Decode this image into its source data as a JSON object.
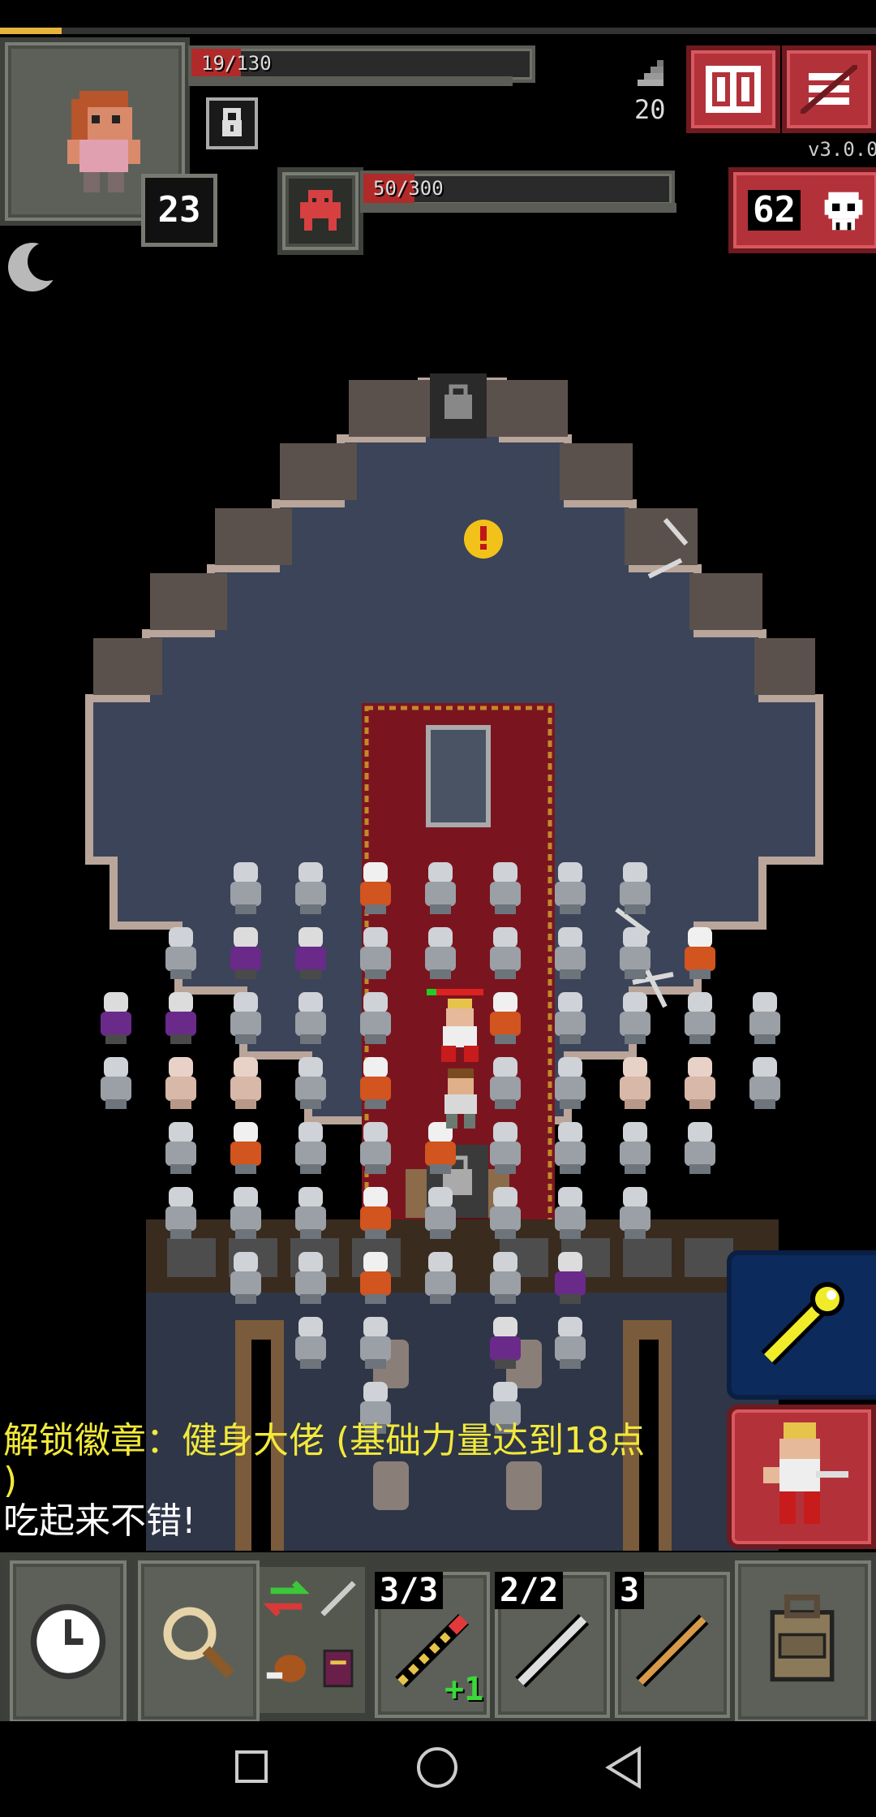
{
  "status": {
    "hp_text": "19/130",
    "hp_fraction": 0.146,
    "exp_fraction": 0.07,
    "level": "23",
    "depth": "20",
    "version": "v3.0.0",
    "enemy_count": "62",
    "target_hp_text": "50/300",
    "target_hp_fraction": 0.167
  },
  "icons": {
    "journal": "journal-icon",
    "menu": "menu-icon",
    "depth": "stairs-icon",
    "key": "key-icon",
    "skull": "skull-icon",
    "target": "boss-icon",
    "moon": "moon-icon",
    "wand": "wand-icon",
    "attack": "dwarf-king-icon",
    "wait": "clock-icon",
    "search": "magnifier-icon",
    "backpack": "backpack-icon"
  },
  "log": {
    "line1": "解锁徽章：健身大佬 (基础力量达到18点",
    "line2": ")",
    "line3": "吃起来不错!"
  },
  "quickslots": [
    {
      "count": "3/3",
      "bonus": "+1",
      "item": "wand"
    },
    {
      "count": "2/2",
      "bonus": "",
      "item": "javelin"
    },
    {
      "count": "3",
      "bonus": "",
      "item": "dart"
    }
  ],
  "colors": {
    "hp": "#b02a2a",
    "exp": "#e8b33a",
    "accent_red": "#b3323a",
    "floor": "#3b4459",
    "carpet": "#7a1520"
  }
}
